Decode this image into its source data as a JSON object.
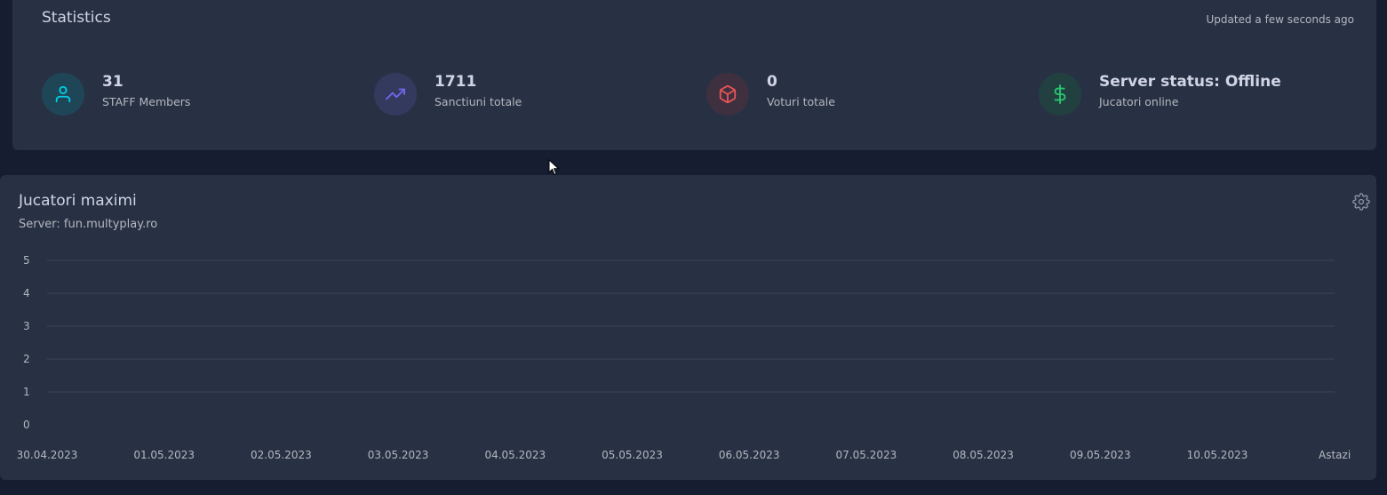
{
  "stats": {
    "title": "Statistics",
    "updated": "Updated a few seconds ago",
    "items": [
      {
        "icon": "user-icon",
        "value": "31",
        "label": "STAFF Members",
        "color": "#00cfe8",
        "bg": "#1f4656"
      },
      {
        "icon": "trending-up-icon",
        "value": "1711",
        "label": "Sanctiuni totale",
        "color": "#7367f0",
        "bg": "#333a5d"
      },
      {
        "icon": "box-icon",
        "value": "0",
        "label": "Voturi totale",
        "color": "#ea5455",
        "bg": "#3e303f"
      },
      {
        "icon": "dollar-sign-icon",
        "value": "Server status: Offline",
        "label": "Jucatori online",
        "color": "#28c76f",
        "bg": "#224040"
      }
    ]
  },
  "chart": {
    "title": "Jucatori maximi",
    "subtitle": "Server: fun.multyplay.ro",
    "settings_icon": "gear-icon"
  },
  "chart_data": {
    "type": "line",
    "x": [
      "30.04.2023",
      "01.05.2023",
      "02.05.2023",
      "03.05.2023",
      "04.05.2023",
      "05.05.2023",
      "06.05.2023",
      "07.05.2023",
      "08.05.2023",
      "09.05.2023",
      "10.05.2023",
      "Astazi"
    ],
    "series": [
      {
        "values": [
          0,
          0,
          0,
          0,
          0,
          0,
          0,
          0,
          0,
          0,
          0,
          0
        ]
      }
    ],
    "yticks": [
      0,
      1,
      2,
      3,
      4,
      5
    ],
    "ylim": [
      0,
      5
    ],
    "grid": true,
    "gradient": [
      "#f07fd6",
      "#7367f0"
    ]
  }
}
